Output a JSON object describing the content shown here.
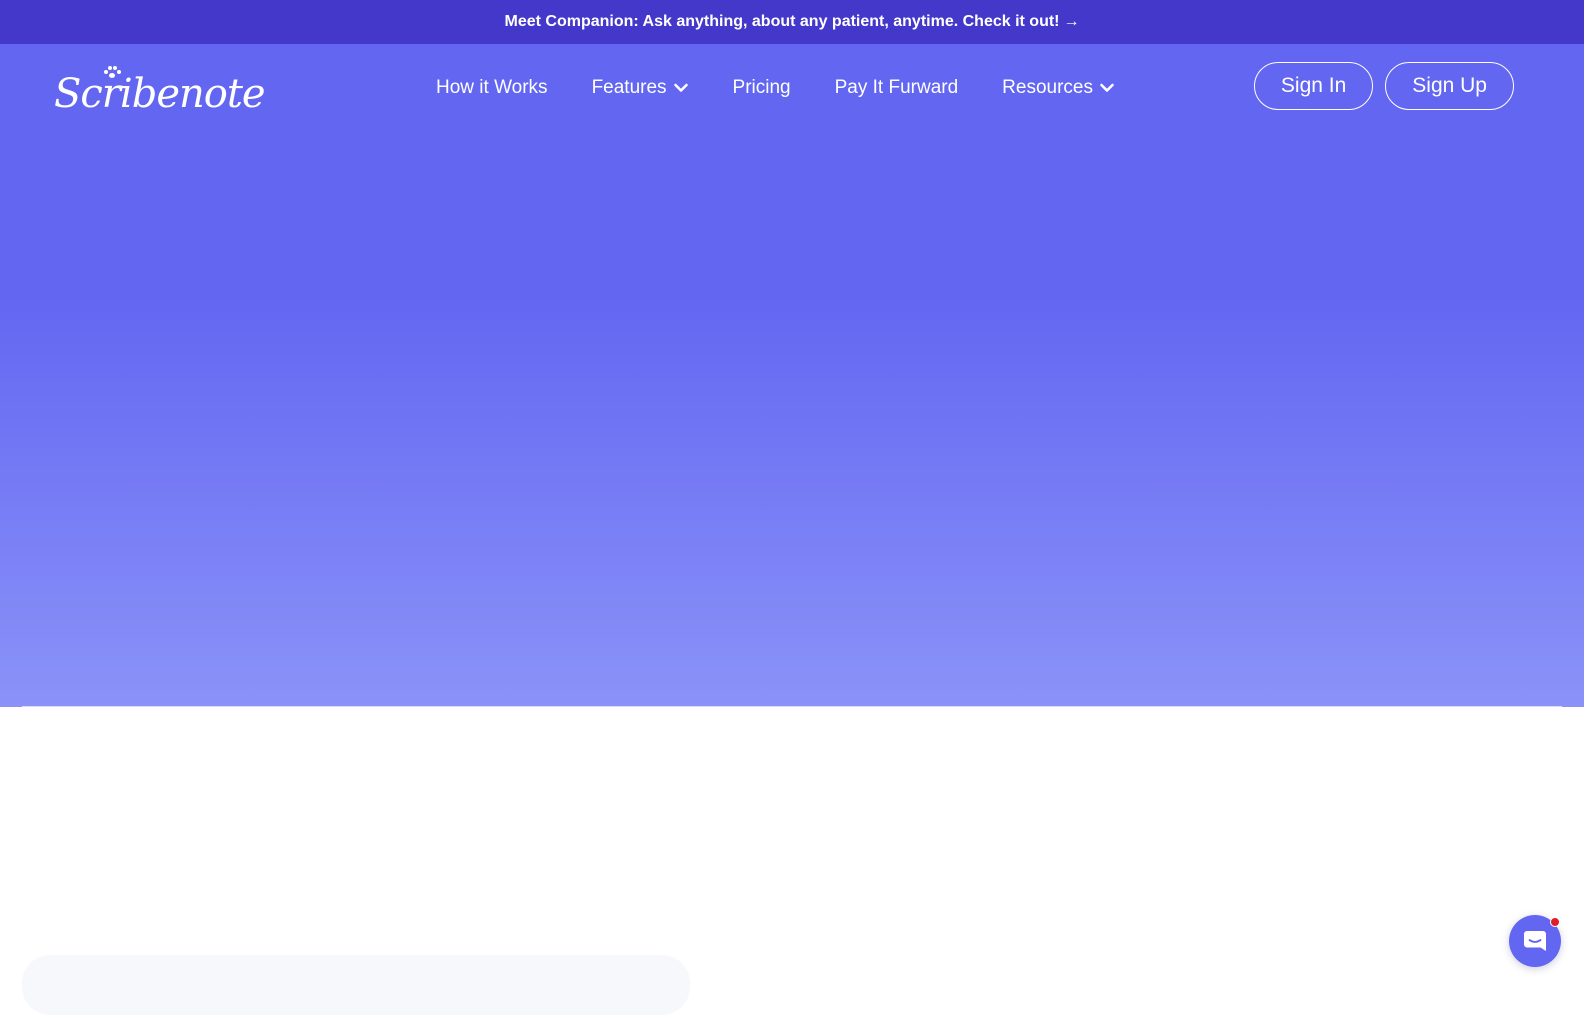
{
  "announcement": {
    "text": "Meet Companion: Ask anything, about any patient, anytime. Check it out!",
    "arrow": "→"
  },
  "header": {
    "logo_text": "Scribenote",
    "nav": [
      {
        "label": "How it Works",
        "has_dropdown": false
      },
      {
        "label": "Features",
        "has_dropdown": true
      },
      {
        "label": "Pricing",
        "has_dropdown": false
      },
      {
        "label": "Pay It Furward",
        "has_dropdown": false
      },
      {
        "label": "Resources",
        "has_dropdown": true
      }
    ],
    "sign_in_label": "Sign In",
    "sign_up_label": "Sign Up"
  },
  "icons": {
    "dropdown": "chevron-down-icon",
    "chat": "chat-bubble-icon",
    "logo_mark": "paw-icon"
  },
  "colors": {
    "announcement_bg": "#4338ca",
    "hero_top": "#6366f1",
    "hero_bottom": "#8b93f8",
    "notification_dot": "#e11d28"
  }
}
